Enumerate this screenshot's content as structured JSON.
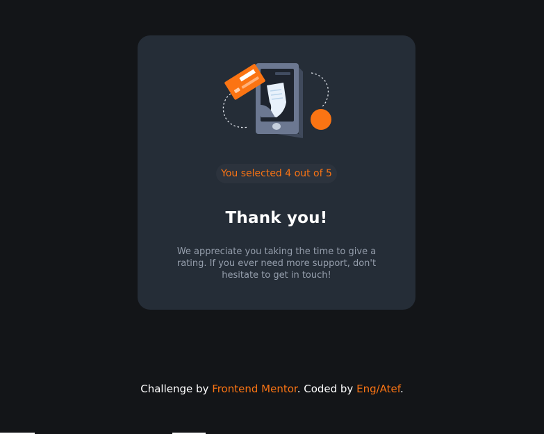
{
  "card": {
    "illustration_icon": "payment-phone-illustration",
    "selection_badge": "You selected 4 out of 5",
    "title": "Thank you!",
    "message": "We appreciate you taking the time to give a rating. If you ever need more support, don't hesitate to get in touch!"
  },
  "footer": {
    "prefix": "Challenge by ",
    "link1": "Frontend Mentor",
    "middle": ". Coded by ",
    "link2": "Eng/Atef",
    "suffix": "."
  },
  "colors": {
    "background": "#131518",
    "card": "#252d37",
    "accent": "#fb7413",
    "muted_text": "#959eac"
  }
}
